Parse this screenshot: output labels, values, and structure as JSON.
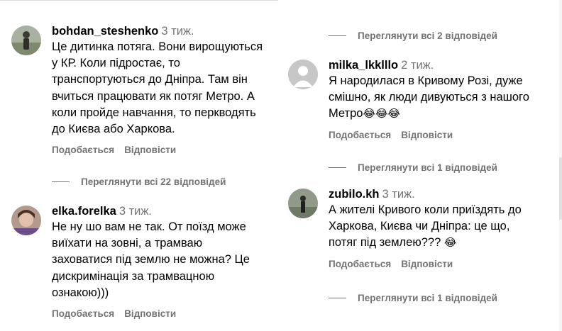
{
  "actions": {
    "like": "Подобається",
    "reply": "Відповісти"
  },
  "left_column": {
    "comments": [
      {
        "username": "bohdan_steshenko",
        "time": "3 тиж.",
        "text": "Це дитинка потяга. Вони вирощуються у КР. Коли підростає, то транспортуються до Дніпра. Там він вчиться працювати як потяг Метро. А коли пройде навчання, то перкводять до Києва або Харкова.",
        "replies_label": "Переглянути всі 22 відповідей"
      },
      {
        "username": "elka.forelka",
        "time": "3 тиж.",
        "text": "Не ну шо вам не так. От поїзд може виїхати на зовні, а трамваю заховатися під землю не можна? Це дискримінація за трамвацною ознакою)))"
      }
    ]
  },
  "right_column": {
    "top_replies_label": "Переглянути всі 2 відповідей",
    "comments": [
      {
        "username": "milka_lkklllo",
        "time": "2 тиж.",
        "text": "Я народилася в Кривому Розі, дуже смішно, як люди дивуються з нашого Метро",
        "emoji": "😂😂😂",
        "replies_label": "Переглянути всі 1 відповідей"
      },
      {
        "username": "zubilo.kh",
        "time": "3 тиж.",
        "text": "А жителі Кривого коли приїздять до Харкова, Києва чи Дніпра: це що, потяг під землею???",
        "emoji": "😂",
        "replies_label": "Переглянути всі 1 відповідей"
      }
    ]
  },
  "colors": {
    "secondary_text": "#737373",
    "primary_text": "#000000",
    "background": "#ffffff"
  },
  "icons": [
    "default-avatar-icon",
    "laughing-emoji-icon"
  ]
}
